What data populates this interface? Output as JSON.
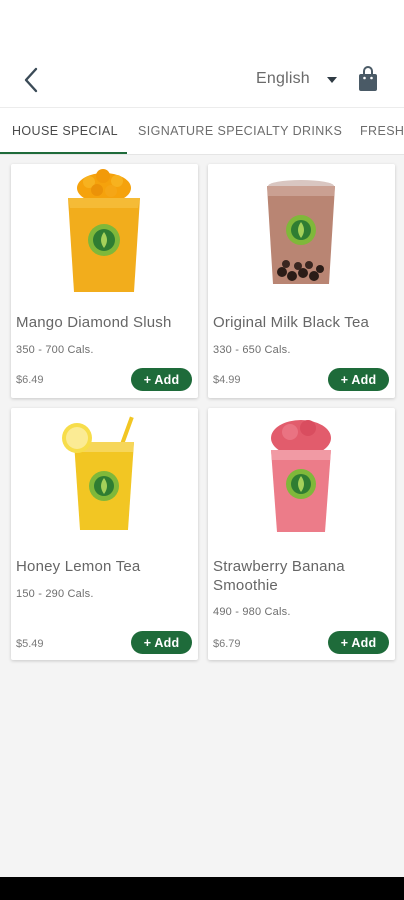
{
  "header": {
    "language": "English",
    "icons": {
      "back": "back-arrow-icon",
      "language_caret": "caret-down-icon",
      "cart": "shopping-bag-icon"
    }
  },
  "tabs": [
    {
      "label": "HOUSE SPECIAL",
      "active": true
    },
    {
      "label": "SIGNATURE SPECIALTY DRINKS",
      "active": false
    },
    {
      "label": "FRESH",
      "active": false
    }
  ],
  "products": [
    {
      "name": "Mango Diamond Slush",
      "calories": "350 - 700 Cals.",
      "price": "$6.49",
      "add_label": "+ Add"
    },
    {
      "name": "Original Milk Black Tea",
      "calories": "330 - 650 Cals.",
      "price": "$4.99",
      "add_label": "+ Add"
    },
    {
      "name": "Honey Lemon Tea",
      "calories": "150 - 290 Cals.",
      "price": "$5.49",
      "add_label": "+ Add"
    },
    {
      "name": "Strawberry Banana Smoothie",
      "calories": "490 - 980 Cals.",
      "price": "$6.79",
      "add_label": "+ Add"
    }
  ],
  "colors": {
    "accent": "#1e6b3a",
    "background": "#f4f4f4",
    "mango": "#f2a71b",
    "milk_tea": "#b07a63",
    "lemon_tea": "#f2c623",
    "smoothie": "#e56f7d"
  }
}
